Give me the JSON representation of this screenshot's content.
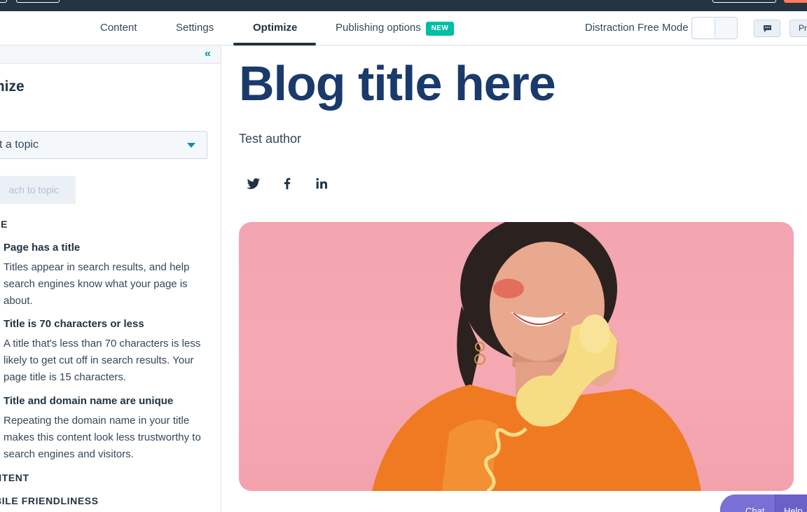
{
  "nav": {
    "tabs": [
      "Content",
      "Settings",
      "Optimize",
      "Publishing options"
    ],
    "active_tab": "Optimize",
    "new_badge": "NEW",
    "distraction_free_label": "Distraction Free Mode",
    "preview_label": "Pr"
  },
  "sidebar": {
    "title": "mize",
    "topic_select_value": "ct a topic",
    "attach_button": "ach to topic",
    "sections": {
      "title_section": "LE",
      "content_section": "NTENT",
      "mobile_section": "BILE FRIENDLINESS"
    },
    "rules": [
      {
        "title": "Page has a title",
        "desc": "Titles appear in search results, and help search engines know what your page is about."
      },
      {
        "title": "Title is 70 characters or less",
        "desc": "A title that's less than 70 characters is less likely to get cut off in search results. Your page title is 15 characters."
      },
      {
        "title": "Title and domain name are unique",
        "desc": "Repeating the domain name in your title makes this content look less trustworthy to search engines and visitors."
      }
    ]
  },
  "main": {
    "blog_title": "Blog title here",
    "author": "Test author",
    "social_icons": [
      "twitter-icon",
      "facebook-icon",
      "linkedin-icon"
    ]
  },
  "chat": {
    "chat_label": "Chat",
    "help_label": "Help"
  },
  "colors": {
    "topbar": "#253342",
    "accent_teal": "#00bda5",
    "link_blue": "#0091ae",
    "title_navy": "#1a3a6b",
    "hero_pink": "#f6a9b3",
    "orange": "#ff7a59"
  }
}
